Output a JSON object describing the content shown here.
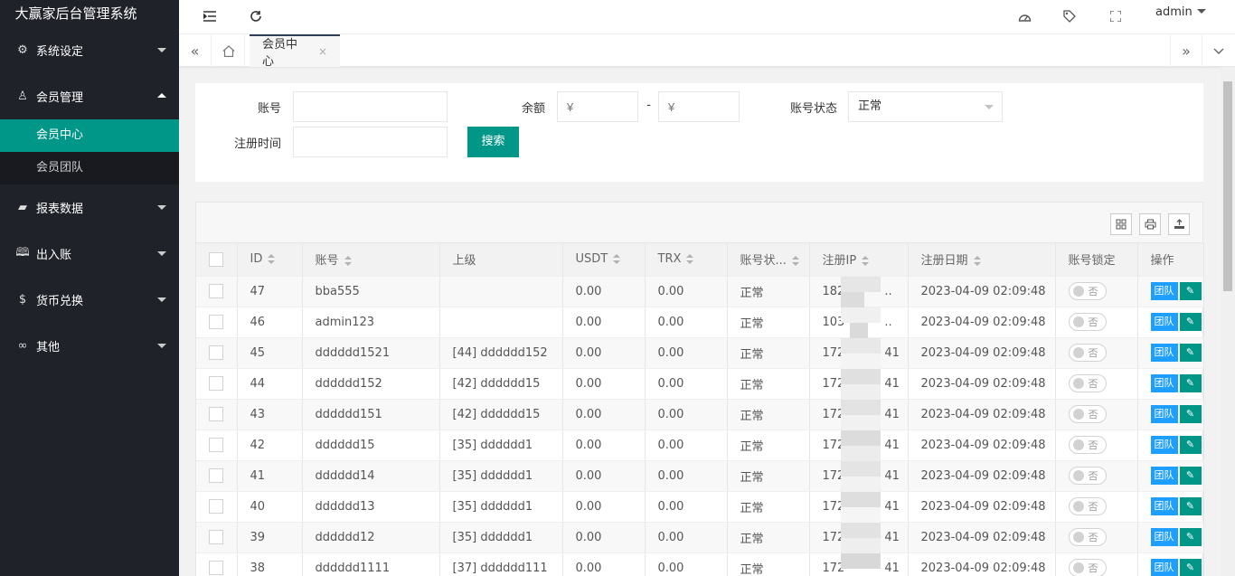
{
  "app": {
    "title": "大赢家后台管理系统"
  },
  "sidebar": {
    "items": [
      {
        "label": "系统设定",
        "icon": "gear-icon",
        "glyph": "⚙",
        "expanded": false
      },
      {
        "label": "会员管理",
        "icon": "user-icon",
        "glyph": "♙",
        "expanded": true,
        "children": [
          {
            "label": "会员中心",
            "active": true
          },
          {
            "label": "会员团队",
            "active": false
          }
        ]
      },
      {
        "label": "报表数据",
        "icon": "report-icon",
        "glyph": "▰",
        "expanded": false
      },
      {
        "label": "出入账",
        "icon": "book-icon",
        "glyph": "🕮",
        "expanded": false
      },
      {
        "label": "货币兑换",
        "icon": "dollar-icon",
        "glyph": "$",
        "expanded": false
      },
      {
        "label": "其他",
        "icon": "link-icon",
        "glyph": "∞",
        "expanded": false
      }
    ]
  },
  "header": {
    "user": "admin",
    "icons": [
      "menu-fold-icon",
      "refresh-icon",
      "theme-icon",
      "tag-icon",
      "fullscreen-icon"
    ]
  },
  "tabs": {
    "items": [
      {
        "label": "会员中心",
        "close": "×"
      }
    ]
  },
  "search": {
    "account_label": "账号",
    "account_value": "",
    "balance_label": "余额",
    "balance_min_placeholder": "¥",
    "balance_sep": "-",
    "balance_max_placeholder": "¥",
    "status_label": "账号状态",
    "status_value": "正常",
    "regtime_label": "注册时间",
    "regtime_value": "",
    "search_button": "搜索"
  },
  "table": {
    "columns": [
      "ID",
      "账号",
      "上级",
      "USDT",
      "TRX",
      "账号状...",
      "注册IP",
      "注册日期",
      "账号锁定",
      "操作"
    ],
    "rows": [
      {
        "id": "47",
        "account": "bba555",
        "parent": "",
        "usdt": "0.00",
        "trx": "0.00",
        "status": "正常",
        "ip": "182",
        "ip_tail": "..",
        "date": "2023-04-09 02:09:48",
        "lock": "否"
      },
      {
        "id": "46",
        "account": "admin123",
        "parent": "",
        "usdt": "0.00",
        "trx": "0.00",
        "status": "正常",
        "ip": "103",
        "ip_tail": "..",
        "date": "2023-04-09 02:09:48",
        "lock": "否"
      },
      {
        "id": "45",
        "account": "dddddd1521",
        "parent": "[44] dddddd152",
        "usdt": "0.00",
        "trx": "0.00",
        "status": "正常",
        "ip": "172",
        "ip_tail": "41",
        "date": "2023-04-09 02:09:48",
        "lock": "否"
      },
      {
        "id": "44",
        "account": "dddddd152",
        "parent": "[42] dddddd15",
        "usdt": "0.00",
        "trx": "0.00",
        "status": "正常",
        "ip": "172",
        "ip_tail": "41",
        "date": "2023-04-09 02:09:48",
        "lock": "否"
      },
      {
        "id": "43",
        "account": "dddddd151",
        "parent": "[42] dddddd15",
        "usdt": "0.00",
        "trx": "0.00",
        "status": "正常",
        "ip": "172",
        "ip_tail": "41",
        "date": "2023-04-09 02:09:48",
        "lock": "否"
      },
      {
        "id": "42",
        "account": "dddddd15",
        "parent": "[35] dddddd1",
        "usdt": "0.00",
        "trx": "0.00",
        "status": "正常",
        "ip": "172",
        "ip_tail": "41",
        "date": "2023-04-09 02:09:48",
        "lock": "否"
      },
      {
        "id": "41",
        "account": "dddddd14",
        "parent": "[35] dddddd1",
        "usdt": "0.00",
        "trx": "0.00",
        "status": "正常",
        "ip": "172",
        "ip_tail": "41",
        "date": "2023-04-09 02:09:48",
        "lock": "否"
      },
      {
        "id": "40",
        "account": "dddddd13",
        "parent": "[35] dddddd1",
        "usdt": "0.00",
        "trx": "0.00",
        "status": "正常",
        "ip": "172",
        "ip_tail": "41",
        "date": "2023-04-09 02:09:48",
        "lock": "否"
      },
      {
        "id": "39",
        "account": "dddddd12",
        "parent": "[35] dddddd1",
        "usdt": "0.00",
        "trx": "0.00",
        "status": "正常",
        "ip": "172",
        "ip_tail": "41",
        "date": "2023-04-09 02:09:48",
        "lock": "否"
      },
      {
        "id": "38",
        "account": "dddddd1111",
        "parent": "[37] dddddd111",
        "usdt": "0.00",
        "trx": "0.00",
        "status": "正常",
        "ip": "172",
        "ip_tail": "41",
        "date": "2023-04-09 02:09:48",
        "lock": "否"
      }
    ],
    "team_button": "团队",
    "edit_glyph": "✎"
  },
  "colors": {
    "sidebar": "#20222a",
    "accent": "#009688",
    "blue": "#1e9fff"
  }
}
